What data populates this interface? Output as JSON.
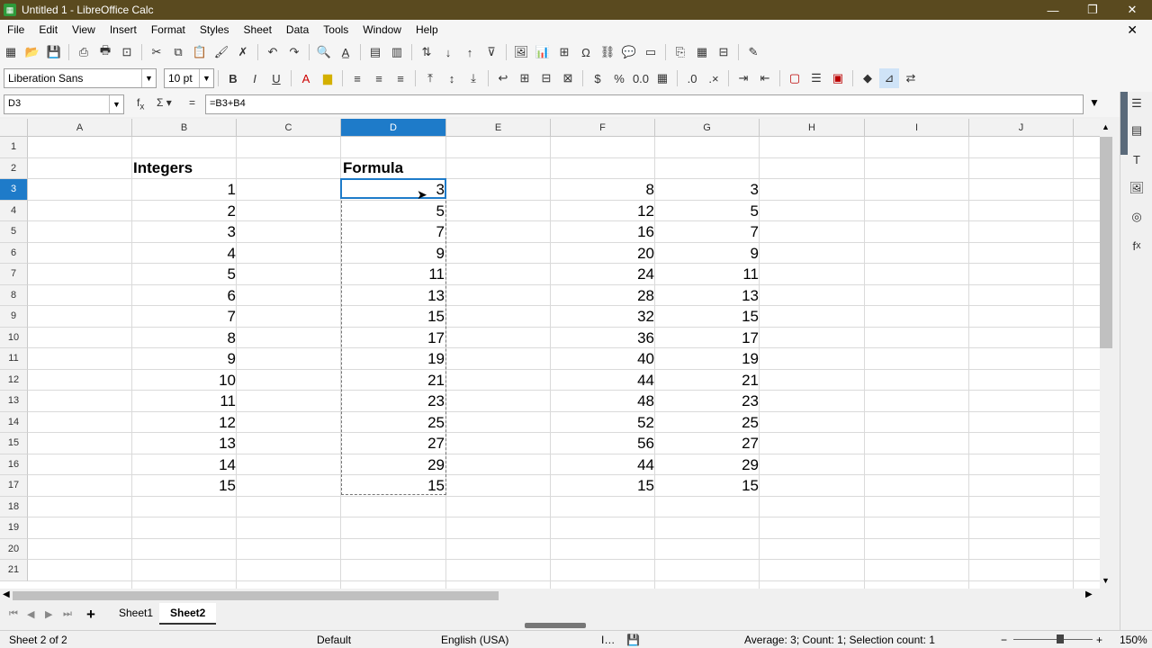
{
  "window": {
    "title": "Untitled 1 - LibreOffice Calc",
    "controls": [
      "—",
      "❐",
      "✕"
    ]
  },
  "menu": [
    "File",
    "Edit",
    "View",
    "Insert",
    "Format",
    "Styles",
    "Sheet",
    "Data",
    "Tools",
    "Window",
    "Help"
  ],
  "formatting": {
    "font_name": "Liberation Sans",
    "font_size": "10 pt"
  },
  "formula_bar": {
    "cell_ref": "D3",
    "formula": "=B3+B4"
  },
  "columns": [
    "A",
    "B",
    "C",
    "D",
    "E",
    "F",
    "G",
    "H",
    "I",
    "J"
  ],
  "selected_column": "D",
  "rows": [
    "1",
    "2",
    "3",
    "4",
    "5",
    "6",
    "7",
    "8",
    "9",
    "10",
    "11",
    "12",
    "13",
    "14",
    "15",
    "16",
    "17",
    "18",
    "19",
    "20",
    "21"
  ],
  "selected_row": "3",
  "headers": {
    "B2": "Integers",
    "D2": "Formula"
  },
  "col_b": [
    "1",
    "2",
    "3",
    "4",
    "5",
    "6",
    "7",
    "8",
    "9",
    "10",
    "11",
    "12",
    "13",
    "14",
    "15"
  ],
  "col_d": [
    "3",
    "5",
    "7",
    "9",
    "11",
    "13",
    "15",
    "17",
    "19",
    "21",
    "23",
    "25",
    "27",
    "29",
    "15"
  ],
  "col_f": [
    "8",
    "12",
    "16",
    "20",
    "24",
    "28",
    "32",
    "36",
    "40",
    "44",
    "48",
    "52",
    "56",
    "44",
    "15"
  ],
  "col_g": [
    "3",
    "5",
    "7",
    "9",
    "11",
    "13",
    "15",
    "17",
    "19",
    "21",
    "23",
    "25",
    "27",
    "29",
    "15"
  ],
  "tabs": [
    "Sheet1",
    "Sheet2"
  ],
  "active_tab": "Sheet2",
  "status": {
    "sheet": "Sheet 2 of 2",
    "page_style": "Default",
    "language": "English (USA)",
    "selection_summary": "Average: 3; Count: 1; Selection count: 1",
    "zoom": "150%"
  }
}
